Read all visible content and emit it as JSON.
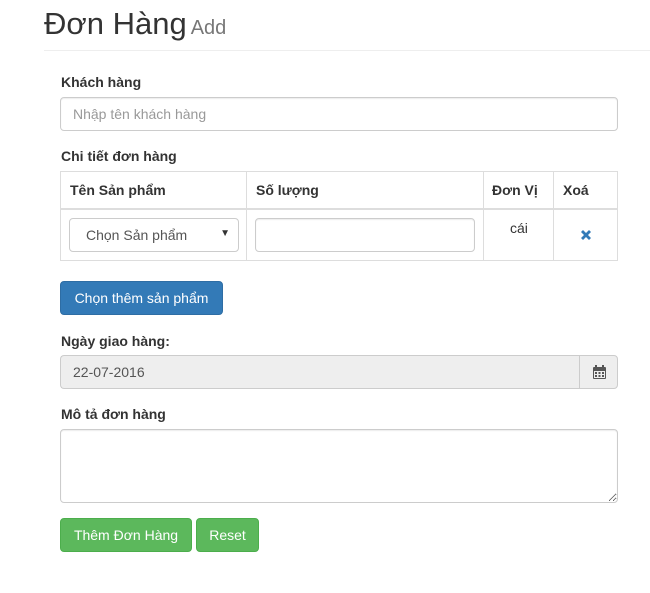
{
  "header": {
    "title": "Đơn Hàng",
    "subtitle": "Add"
  },
  "customer": {
    "label": "Khách hàng",
    "placeholder": "Nhập tên khách hàng"
  },
  "order_details": {
    "label": "Chi tiết đơn hàng",
    "columns": [
      "Tên Sản phẩm",
      "Số lượng",
      "Đơn Vị",
      "Xoá"
    ],
    "rows": [
      {
        "product": "Chọn Sản phẩm",
        "quantity": "",
        "unit": "cái",
        "delete_icon": "remove-icon"
      }
    ]
  },
  "add_product_button": "Chọn thêm sản phẩm",
  "delivery": {
    "label": "Ngày giao hàng:",
    "date": "22-07-2016",
    "icon": "calendar-icon"
  },
  "description": {
    "label": "Mô tả đơn hàng",
    "value": ""
  },
  "actions": {
    "submit": "Thêm Đơn Hàng",
    "reset": "Reset"
  },
  "colors": {
    "primary": "#337ab7",
    "success": "#5cb85c",
    "delete": "#337ab7"
  }
}
